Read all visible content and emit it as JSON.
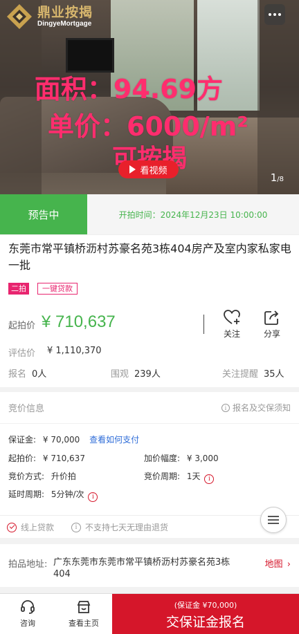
{
  "hero": {
    "logo_cn": "鼎业按揭",
    "logo_en": "DingyeMortgage",
    "overlay_line1": "面积：94.69方",
    "overlay_line2": "单价：6000/m²",
    "overlay_line3": "可按揭",
    "video_button": "看视频",
    "pager_current": "1",
    "pager_total": "/8"
  },
  "status": {
    "badge": "预告中",
    "start_time": "开拍时间：2024年12月23日 10:00:00"
  },
  "lot": {
    "title": "东莞市常平镇桥沥村苏豪名苑3栋404房产及室内家私家电一批",
    "tag_round": "二拍",
    "tag_loan": "一键贷款",
    "price_label": "起拍价",
    "price_value": "¥ 710,637",
    "follow_label": "关注",
    "share_label": "分享",
    "eval_label": "评估价",
    "eval_value": "¥ 1,110,370",
    "signup_label": "报名",
    "signup_value": "0人",
    "watch_label": "围观",
    "watch_value": "239人",
    "remind_label": "关注提醒",
    "remind_value": "35人"
  },
  "bid": {
    "header": "竞价信息",
    "notice": "报名及交保须知",
    "deposit_label": "保证金:",
    "deposit_value": "¥ 70,000",
    "how_to_pay": "查看如何支付",
    "start_label": "起拍价:",
    "start_value": "¥ 710,637",
    "increment_label": "加价幅度:",
    "increment_value": "¥ 3,000",
    "method_label": "竞价方式:",
    "method_value": "升价拍",
    "cycle_label": "竞价周期:",
    "cycle_value": "1天",
    "delay_label": "延时周期:",
    "delay_value": "5分钟/次"
  },
  "services": {
    "online_loan": "线上贷款",
    "no_return": "不支持七天无理由退货"
  },
  "address": {
    "label": "拍品地址:",
    "value": "广东东莞市东莞市常平镇桥沥村苏豪名苑3栋404",
    "map": "地图"
  },
  "bottom": {
    "consult": "咨询",
    "home": "查看主页",
    "cta_sub": "(保证金 ¥70,000)",
    "cta_main": "交保证金报名"
  },
  "colors": {
    "green": "#46b44d",
    "red": "#d5162a",
    "pink": "#e8256f",
    "link_blue": "#2e6cd8"
  }
}
